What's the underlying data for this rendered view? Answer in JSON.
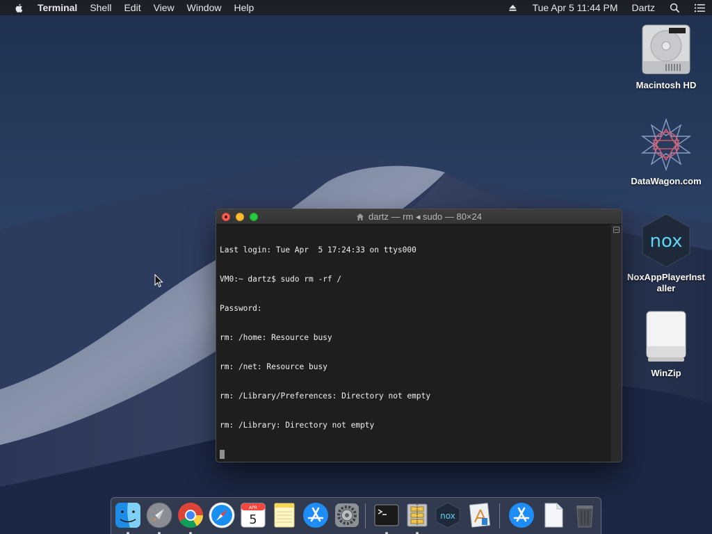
{
  "menubar": {
    "app_name": "Terminal",
    "menus": [
      "Shell",
      "Edit",
      "View",
      "Window",
      "Help"
    ],
    "clock": "Tue Apr 5  11:44 PM",
    "user": "Dartz"
  },
  "desktop": {
    "icons": [
      {
        "label": "Macintosh HD",
        "icon": "hard-drive-icon"
      },
      {
        "label": "DataWagon.com",
        "icon": "star-polygon-icon"
      },
      {
        "label": "NoxAppPlayerInstaller",
        "icon": "nox-icon"
      },
      {
        "label": "WinZip",
        "icon": "removable-drive-icon"
      }
    ]
  },
  "terminal": {
    "title": "dartz — rm ◂ sudo — 80×24",
    "lines": [
      "Last login: Tue Apr  5 17:24:33 on ttys000",
      "VM0:~ dartz$ sudo rm -rf /",
      "Password:",
      "rm: /home: Resource busy",
      "rm: /net: Resource busy",
      "rm: /Library/Preferences: Directory not empty",
      "rm: /Library: Directory not empty"
    ]
  },
  "dock": {
    "calendar_month": "APR",
    "calendar_day": "5",
    "nox_label": "nox",
    "items": [
      {
        "name": "Finder",
        "icon": "finder-icon",
        "running": true
      },
      {
        "name": "Launchpad",
        "icon": "rocket-icon",
        "running": true
      },
      {
        "name": "Google Chrome",
        "icon": "chrome-icon",
        "running": true
      },
      {
        "name": "Safari",
        "icon": "compass-icon",
        "running": false
      },
      {
        "name": "Calendar",
        "icon": "calendar-icon",
        "running": false
      },
      {
        "name": "Notes",
        "icon": "notes-icon",
        "running": false
      },
      {
        "name": "App Store",
        "icon": "app-store-icon",
        "running": false
      },
      {
        "name": "System Preferences",
        "icon": "gear-icon",
        "running": false
      },
      {
        "name": "Terminal",
        "icon": "terminal-icon",
        "running": true
      },
      {
        "name": "Archive Utility",
        "icon": "archive-icon",
        "running": true
      },
      {
        "name": "Nox",
        "icon": "nox-icon",
        "running": false
      },
      {
        "name": "Installer",
        "icon": "installer-icon",
        "running": false
      },
      {
        "name": "App Store Downloads",
        "icon": "app-store-icon",
        "running": false
      },
      {
        "name": "Documents",
        "icon": "document-icon",
        "running": false
      },
      {
        "name": "Trash",
        "icon": "trash-icon",
        "running": false
      }
    ]
  }
}
